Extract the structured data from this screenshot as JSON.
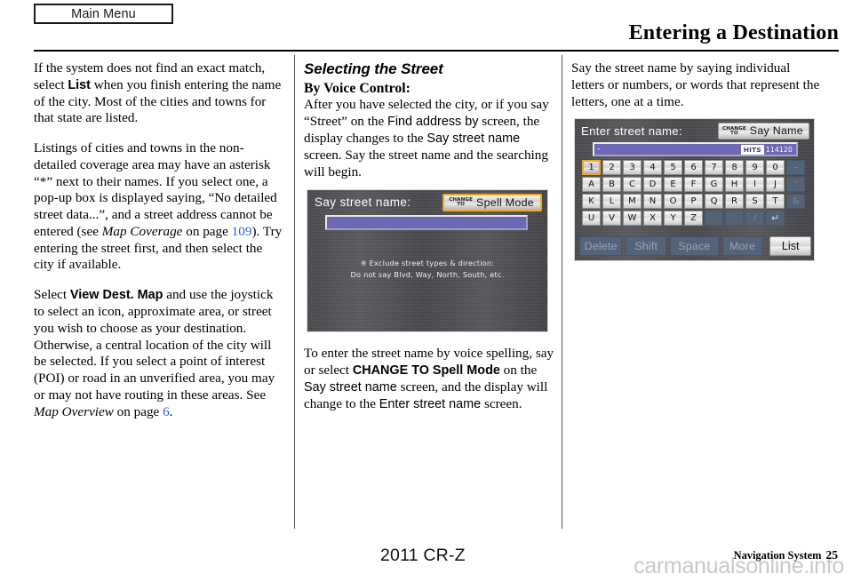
{
  "header": {
    "tab_label": "Main Menu",
    "title": "Entering a Destination"
  },
  "columns": {
    "col1": {
      "p1_a": "If the system does not find an exact match, select ",
      "p1_b": "List",
      "p1_c": " when you finish entering the name of the city. Most of the cities and towns for that state are listed.",
      "p2_a": "Listings of cities and towns in the non-detailed coverage area may have an asterisk “*” next to their names. If you select one, a pop-up box is displayed saying, “No detailed street data...”, and a street address cannot be entered (see ",
      "p2_ital": "Map Coverage",
      "p2_b": " on page ",
      "p2_link": "109",
      "p2_c": "). Try entering the street first, and then select the city if available.",
      "p3_a": "Select ",
      "p3_b": "View Dest. Map",
      "p3_c": " and use the joystick to select an icon, approximate area, or street you wish to choose as your destination. Otherwise, a central location of the city will be selected. If you select a point of interest (POI) or road in an unverified area, you may or may not have routing in these areas. See ",
      "p3_ital": "Map Overview",
      "p3_d": " on page ",
      "p3_link": "6",
      "p3_e": "."
    },
    "col2": {
      "section_heading": "Selecting the Street",
      "sub_heading": "By Voice Control:",
      "p1_a": "After you have selected the city, or if you say “Street” on the ",
      "p1_b": "Find address by",
      "p1_c": " screen, the display changes to the ",
      "p1_d": "Say street name",
      "p1_e": " screen. Say the street name and the searching will begin.",
      "p2_a": "To enter the street name by voice spelling, say or select ",
      "p2_b": "CHANGE TO Spell Mode",
      "p2_c": " on the ",
      "p2_d": "Say street name",
      "p2_e": " screen, and the display will change to the ",
      "p2_f": "Enter street name",
      "p2_g": " screen."
    },
    "col3": {
      "p1": "Say the street name by saying individual letters or numbers, or words that represent the letters, one at a time."
    }
  },
  "say_street_screen": {
    "title": "Say street name:",
    "button_small_line1": "CHANGE",
    "button_small_line2": "TO",
    "button_label": "Spell Mode",
    "input_value": "",
    "hint_line1": "※ Exclude street types & direction:",
    "hint_line2": "Do not say Blvd, Way, North, South, etc."
  },
  "enter_street_screen": {
    "title": "Enter street name:",
    "button_small_line1": "CHANGE",
    "button_small_line2": "TO",
    "button_label": "Say Name",
    "input_value": "-",
    "hits_label": "HITS",
    "hits_count": "114120",
    "keyboard_rows": [
      [
        "1",
        "2",
        "3",
        "4",
        "5",
        "6",
        "7",
        "8",
        "9",
        "0",
        "–"
      ],
      [
        "A",
        "B",
        "C",
        "D",
        "E",
        "F",
        "G",
        "H",
        "I",
        "J",
        "'"
      ],
      [
        "K",
        "L",
        "M",
        "N",
        "O",
        "P",
        "Q",
        "R",
        "S",
        "T",
        "&"
      ],
      [
        "U",
        "V",
        "W",
        "X",
        "Y",
        "Z",
        "",
        "",
        "/",
        "↵"
      ]
    ],
    "selected_key": "1",
    "function_keys": {
      "delete": "Delete",
      "shift": "Shift",
      "space": "Space",
      "more": "More",
      "list": "List"
    }
  },
  "footer": {
    "model": "2011 CR-Z",
    "doc_name": "Navigation System",
    "page_number": "25",
    "watermark": "carmanualsonline.info"
  },
  "colors": {
    "highlight_border": "#f0a81e",
    "input_purple": "#6d68b4",
    "xref_link": "#2a5fd6"
  }
}
